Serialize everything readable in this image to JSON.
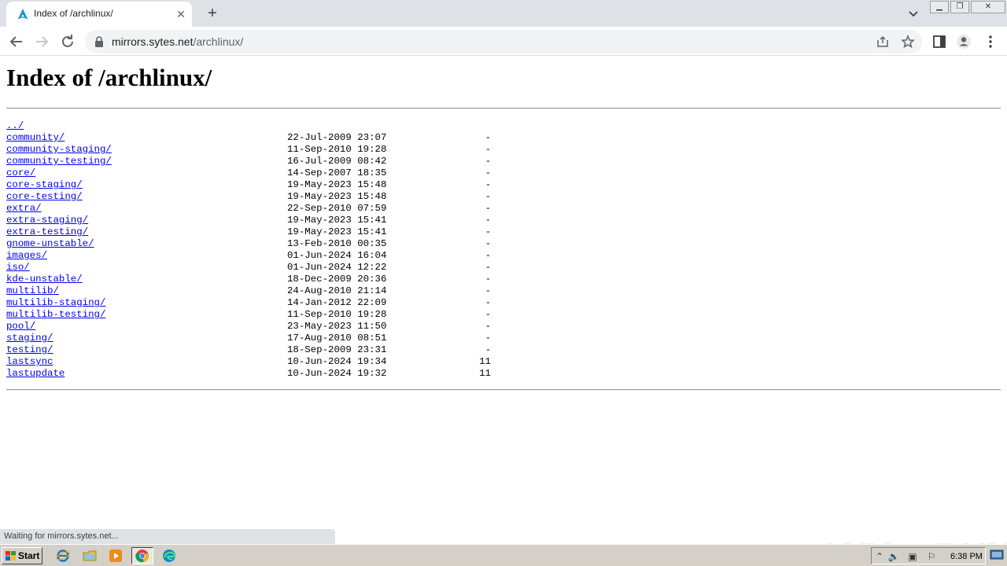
{
  "browser": {
    "tab_title": "Index of /archlinux/",
    "tab_favicon": "arch-linux-icon",
    "url_host": "mirrors.sytes.net",
    "url_path": "/archlinux/",
    "status_text": "Waiting for mirrors.sytes.net..."
  },
  "page": {
    "title": "Index of /archlinux/",
    "parent_link": "../",
    "entries": [
      {
        "name": "community/",
        "date": "22-Jul-2009 23:07",
        "size": "-"
      },
      {
        "name": "community-staging/",
        "date": "11-Sep-2010 19:28",
        "size": "-"
      },
      {
        "name": "community-testing/",
        "date": "16-Jul-2009 08:42",
        "size": "-"
      },
      {
        "name": "core/",
        "date": "14-Sep-2007 18:35",
        "size": "-"
      },
      {
        "name": "core-staging/",
        "date": "19-May-2023 15:48",
        "size": "-"
      },
      {
        "name": "core-testing/",
        "date": "19-May-2023 15:48",
        "size": "-"
      },
      {
        "name": "extra/",
        "date": "22-Sep-2010 07:59",
        "size": "-"
      },
      {
        "name": "extra-staging/",
        "date": "19-May-2023 15:41",
        "size": "-"
      },
      {
        "name": "extra-testing/",
        "date": "19-May-2023 15:41",
        "size": "-"
      },
      {
        "name": "gnome-unstable/",
        "date": "13-Feb-2010 00:35",
        "size": "-"
      },
      {
        "name": "images/",
        "date": "01-Jun-2024 16:04",
        "size": "-"
      },
      {
        "name": "iso/",
        "date": "01-Jun-2024 12:22",
        "size": "-"
      },
      {
        "name": "kde-unstable/",
        "date": "18-Dec-2009 20:36",
        "size": "-"
      },
      {
        "name": "multilib/",
        "date": "24-Aug-2010 21:14",
        "size": "-"
      },
      {
        "name": "multilib-staging/",
        "date": "14-Jan-2012 22:09",
        "size": "-"
      },
      {
        "name": "multilib-testing/",
        "date": "11-Sep-2010 19:28",
        "size": "-"
      },
      {
        "name": "pool/",
        "date": "23-May-2023 11:50",
        "size": "-"
      },
      {
        "name": "staging/",
        "date": "17-Aug-2010 08:51",
        "size": "-"
      },
      {
        "name": "testing/",
        "date": "18-Sep-2009 23:31",
        "size": "-"
      },
      {
        "name": "lastsync",
        "date": "10-Jun-2024 19:34",
        "size": "11"
      },
      {
        "name": "lastupdate",
        "date": "10-Jun-2024 19:32",
        "size": "11"
      }
    ]
  },
  "watermark": "ANY RUN",
  "taskbar": {
    "start_label": "Start",
    "clock": "6:38 PM",
    "apps": [
      "ie-icon",
      "explorer-folder-icon",
      "media-player-icon",
      "chrome-icon",
      "edge-icon"
    ]
  },
  "colors": {
    "link": "#0000ee",
    "tabstrip": "#dee1e6",
    "taskbar": "#d4d0c8"
  }
}
